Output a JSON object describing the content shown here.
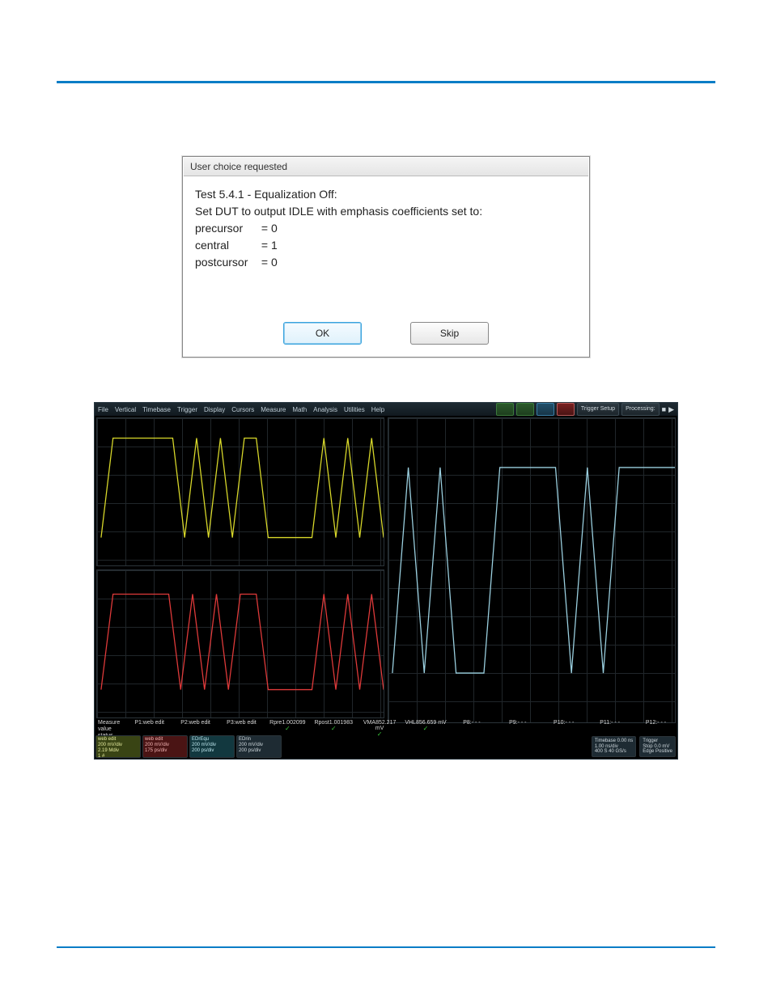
{
  "dialog": {
    "title": "User choice requested",
    "heading": "Test 5.4.1 - Equalization Off:",
    "instruction": "Set DUT to output IDLE with emphasis coefficients set to:",
    "coeffs": [
      {
        "label": "precursor",
        "value": "= 0"
      },
      {
        "label": "central",
        "value": "= 1"
      },
      {
        "label": "postcursor",
        "value": "= 0"
      }
    ],
    "ok_label": "OK",
    "skip_label": "Skip"
  },
  "scope": {
    "menu": [
      "File",
      "Vertical",
      "Timebase",
      "Trigger",
      "Display",
      "Cursors",
      "Measure",
      "Math",
      "Analysis",
      "Utilities",
      "Help"
    ],
    "trigger_setup_label": "Trigger Setup",
    "processing_label": "Processing:",
    "measure_row_labels": [
      "Measure",
      "value",
      "status"
    ],
    "measurements": [
      {
        "name": "P1:web edit",
        "value": "",
        "ok": false
      },
      {
        "name": "P2:web edit",
        "value": "",
        "ok": false
      },
      {
        "name": "P3:web edit",
        "value": "",
        "ok": false
      },
      {
        "name": "Rpre",
        "value": "1.002099",
        "ok": true
      },
      {
        "name": "Rpost",
        "value": "1.001983",
        "ok": true
      },
      {
        "name": "VMA",
        "value": "852.217 mV",
        "ok": true
      },
      {
        "name": "VHL",
        "value": "856.659 mV",
        "ok": true
      },
      {
        "name": "P8:- - -",
        "value": "",
        "ok": false
      },
      {
        "name": "P9:- - -",
        "value": "",
        "ok": false
      },
      {
        "name": "P10:- - -",
        "value": "",
        "ok": false
      },
      {
        "name": "P11:- - -",
        "value": "",
        "ok": false
      },
      {
        "name": "P12:- - -",
        "value": "",
        "ok": false
      }
    ],
    "channels": [
      {
        "class": "ch-yellow",
        "title": "web edit",
        "l1": "200 mV/div",
        "l2": "2.19 Mdiv",
        "l3": "1 #"
      },
      {
        "class": "ch-red",
        "title": "web edit",
        "l1": "200 mV/div",
        "l2": "175 ps/div",
        "l3": ""
      },
      {
        "class": "ch-cyan",
        "title": "EDrEqu",
        "l1": "200 mV/div",
        "l2": "200 ps/div",
        "l3": ""
      },
      {
        "class": "ch-grey",
        "title": "EDrin",
        "l1": "200 mV/div",
        "l2": "200 ps/div",
        "l3": ""
      }
    ],
    "bottom_right": {
      "timebase_label": "Timebase",
      "timebase_pos": "0.00 ns",
      "timebase_scale": "1.00 ns/div",
      "timebase_acq": "400 S   40 GS/s",
      "trigger_label": "Trigger",
      "trigger_mode": "Stop",
      "trigger_level": "0.0 mV",
      "trigger_edge": "Edge   Positive"
    }
  }
}
